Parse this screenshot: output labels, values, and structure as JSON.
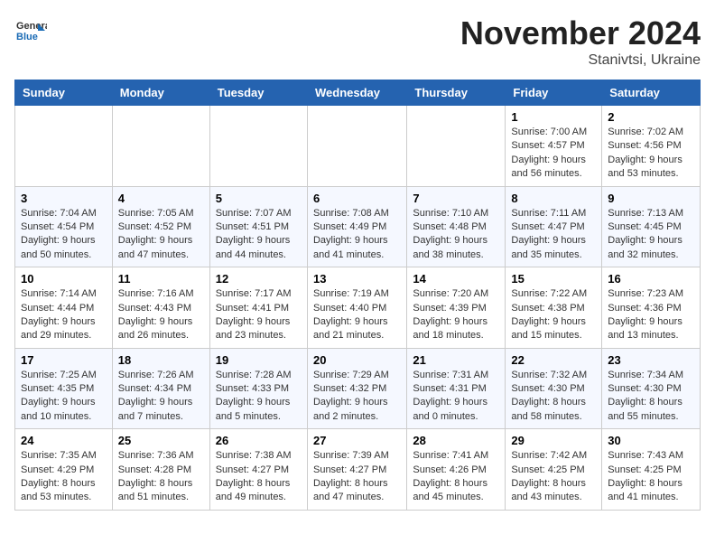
{
  "header": {
    "logo": {
      "general": "General",
      "blue": "Blue"
    },
    "title": "November 2024",
    "subtitle": "Stanivtsi, Ukraine"
  },
  "weekdays": [
    "Sunday",
    "Monday",
    "Tuesday",
    "Wednesday",
    "Thursday",
    "Friday",
    "Saturday"
  ],
  "weeks": [
    [
      {
        "day": "",
        "info": ""
      },
      {
        "day": "",
        "info": ""
      },
      {
        "day": "",
        "info": ""
      },
      {
        "day": "",
        "info": ""
      },
      {
        "day": "",
        "info": ""
      },
      {
        "day": "1",
        "info": "Sunrise: 7:00 AM\nSunset: 4:57 PM\nDaylight: 9 hours and 56 minutes."
      },
      {
        "day": "2",
        "info": "Sunrise: 7:02 AM\nSunset: 4:56 PM\nDaylight: 9 hours and 53 minutes."
      }
    ],
    [
      {
        "day": "3",
        "info": "Sunrise: 7:04 AM\nSunset: 4:54 PM\nDaylight: 9 hours and 50 minutes."
      },
      {
        "day": "4",
        "info": "Sunrise: 7:05 AM\nSunset: 4:52 PM\nDaylight: 9 hours and 47 minutes."
      },
      {
        "day": "5",
        "info": "Sunrise: 7:07 AM\nSunset: 4:51 PM\nDaylight: 9 hours and 44 minutes."
      },
      {
        "day": "6",
        "info": "Sunrise: 7:08 AM\nSunset: 4:49 PM\nDaylight: 9 hours and 41 minutes."
      },
      {
        "day": "7",
        "info": "Sunrise: 7:10 AM\nSunset: 4:48 PM\nDaylight: 9 hours and 38 minutes."
      },
      {
        "day": "8",
        "info": "Sunrise: 7:11 AM\nSunset: 4:47 PM\nDaylight: 9 hours and 35 minutes."
      },
      {
        "day": "9",
        "info": "Sunrise: 7:13 AM\nSunset: 4:45 PM\nDaylight: 9 hours and 32 minutes."
      }
    ],
    [
      {
        "day": "10",
        "info": "Sunrise: 7:14 AM\nSunset: 4:44 PM\nDaylight: 9 hours and 29 minutes."
      },
      {
        "day": "11",
        "info": "Sunrise: 7:16 AM\nSunset: 4:43 PM\nDaylight: 9 hours and 26 minutes."
      },
      {
        "day": "12",
        "info": "Sunrise: 7:17 AM\nSunset: 4:41 PM\nDaylight: 9 hours and 23 minutes."
      },
      {
        "day": "13",
        "info": "Sunrise: 7:19 AM\nSunset: 4:40 PM\nDaylight: 9 hours and 21 minutes."
      },
      {
        "day": "14",
        "info": "Sunrise: 7:20 AM\nSunset: 4:39 PM\nDaylight: 9 hours and 18 minutes."
      },
      {
        "day": "15",
        "info": "Sunrise: 7:22 AM\nSunset: 4:38 PM\nDaylight: 9 hours and 15 minutes."
      },
      {
        "day": "16",
        "info": "Sunrise: 7:23 AM\nSunset: 4:36 PM\nDaylight: 9 hours and 13 minutes."
      }
    ],
    [
      {
        "day": "17",
        "info": "Sunrise: 7:25 AM\nSunset: 4:35 PM\nDaylight: 9 hours and 10 minutes."
      },
      {
        "day": "18",
        "info": "Sunrise: 7:26 AM\nSunset: 4:34 PM\nDaylight: 9 hours and 7 minutes."
      },
      {
        "day": "19",
        "info": "Sunrise: 7:28 AM\nSunset: 4:33 PM\nDaylight: 9 hours and 5 minutes."
      },
      {
        "day": "20",
        "info": "Sunrise: 7:29 AM\nSunset: 4:32 PM\nDaylight: 9 hours and 2 minutes."
      },
      {
        "day": "21",
        "info": "Sunrise: 7:31 AM\nSunset: 4:31 PM\nDaylight: 9 hours and 0 minutes."
      },
      {
        "day": "22",
        "info": "Sunrise: 7:32 AM\nSunset: 4:30 PM\nDaylight: 8 hours and 58 minutes."
      },
      {
        "day": "23",
        "info": "Sunrise: 7:34 AM\nSunset: 4:30 PM\nDaylight: 8 hours and 55 minutes."
      }
    ],
    [
      {
        "day": "24",
        "info": "Sunrise: 7:35 AM\nSunset: 4:29 PM\nDaylight: 8 hours and 53 minutes."
      },
      {
        "day": "25",
        "info": "Sunrise: 7:36 AM\nSunset: 4:28 PM\nDaylight: 8 hours and 51 minutes."
      },
      {
        "day": "26",
        "info": "Sunrise: 7:38 AM\nSunset: 4:27 PM\nDaylight: 8 hours and 49 minutes."
      },
      {
        "day": "27",
        "info": "Sunrise: 7:39 AM\nSunset: 4:27 PM\nDaylight: 8 hours and 47 minutes."
      },
      {
        "day": "28",
        "info": "Sunrise: 7:41 AM\nSunset: 4:26 PM\nDaylight: 8 hours and 45 minutes."
      },
      {
        "day": "29",
        "info": "Sunrise: 7:42 AM\nSunset: 4:25 PM\nDaylight: 8 hours and 43 minutes."
      },
      {
        "day": "30",
        "info": "Sunrise: 7:43 AM\nSunset: 4:25 PM\nDaylight: 8 hours and 41 minutes."
      }
    ]
  ]
}
